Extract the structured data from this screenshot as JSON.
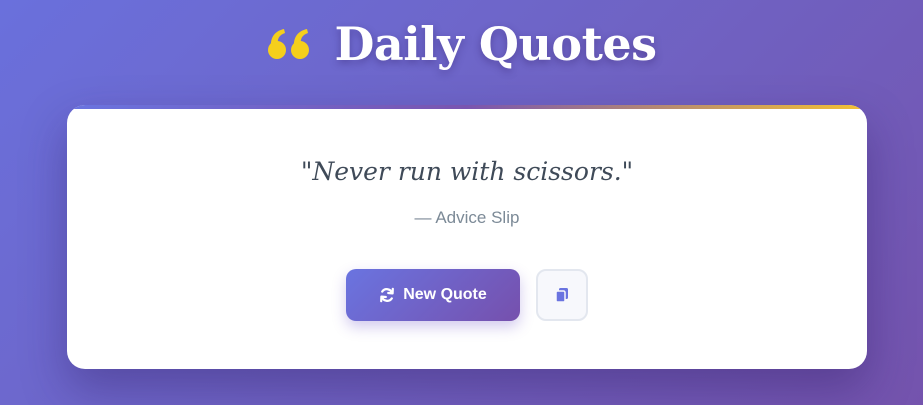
{
  "header": {
    "title": "Daily Quotes",
    "icon": "quote-icon",
    "icon_color": "#f5cf1c"
  },
  "quote": {
    "text": "\"Never run with scissors.\"",
    "author": "— Advice Slip"
  },
  "actions": {
    "new_quote_label": "New Quote",
    "new_quote_icon": "refresh-icon",
    "copy_icon": "copy-icon",
    "accent": "#6a74e0"
  },
  "colors": {
    "background_start": "#6a70dc",
    "background_end": "#7453ad",
    "card": "#ffffff",
    "gold": "#f4c232"
  }
}
